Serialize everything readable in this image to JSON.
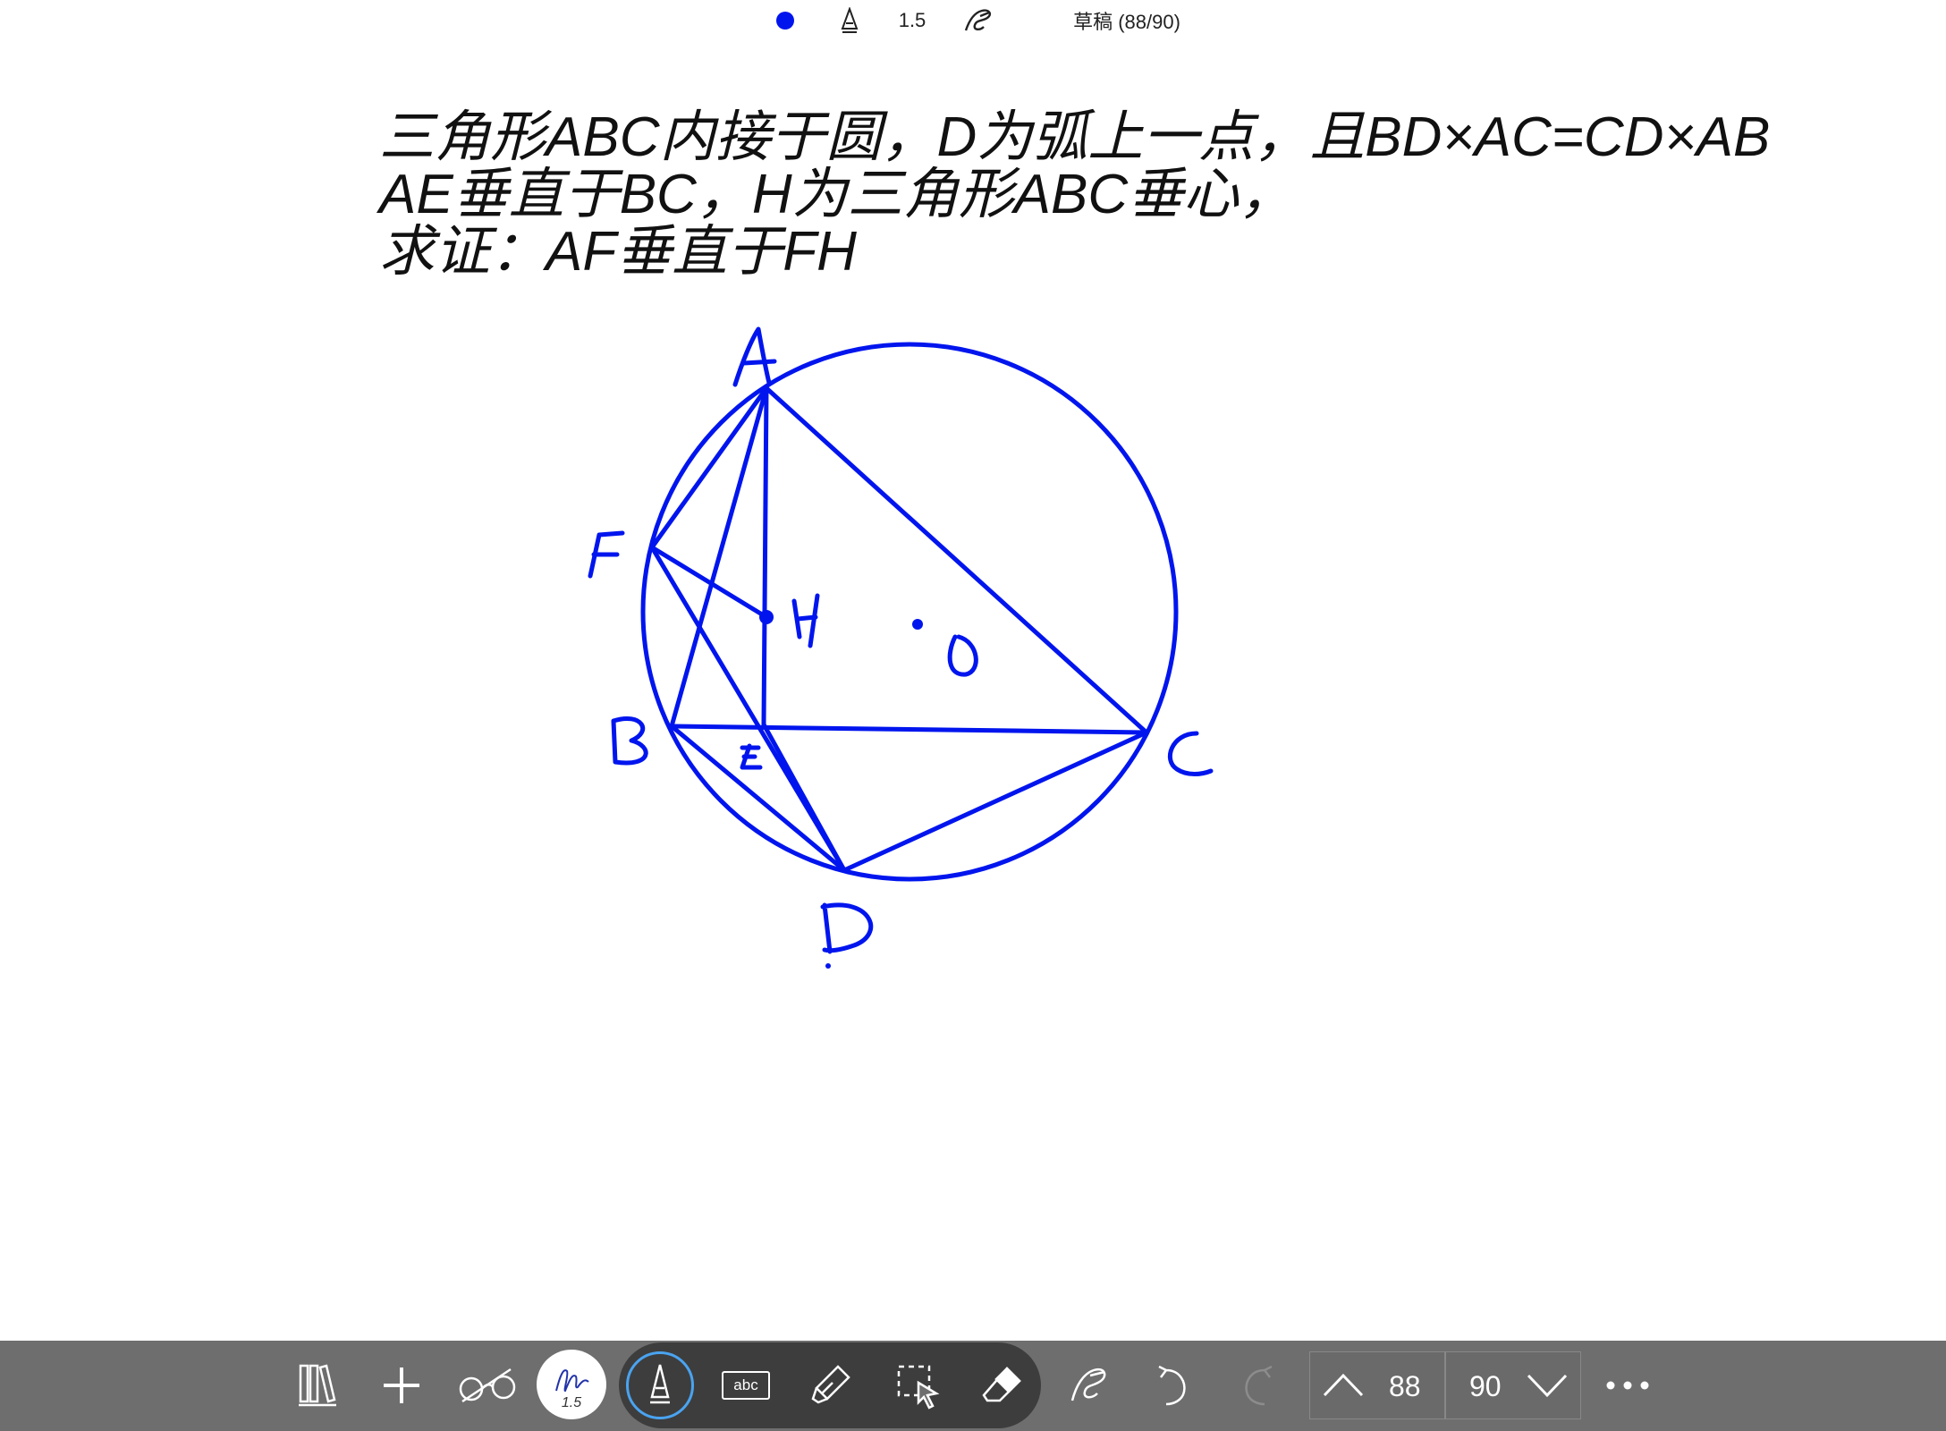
{
  "top_toolbar": {
    "pen_color": "#0015ee",
    "pen_size": "1.5",
    "document_title": "草稿 (88/90)"
  },
  "document": {
    "lines": [
      "三角形ABC内接于圆，D为弧上一点，且BD×AC=CD×AB",
      "AE垂直于BC，H为三角形ABC垂心，",
      "求证：AF垂直于FH"
    ]
  },
  "drawing": {
    "ink_color": "#0015ee",
    "handwritten_labels": [
      "A",
      "F",
      "H",
      "O",
      "B",
      "E",
      "C",
      "D"
    ]
  },
  "bottom_toolbar": {
    "tools": [
      "library-icon",
      "add-icon",
      "glasses-icon",
      "pen-settings",
      "pen-icon",
      "text-box-icon",
      "highlighter-icon",
      "lasso-select-icon",
      "eraser-icon",
      "ink-to-shape-icon",
      "undo-icon",
      "redo-icon"
    ],
    "pen_size": "1.5",
    "text_tool_label": "abc",
    "current_page": "88",
    "total_pages": "90",
    "bar_color": "#6e6e6e",
    "active_ring_color": "#4aa3f0"
  }
}
